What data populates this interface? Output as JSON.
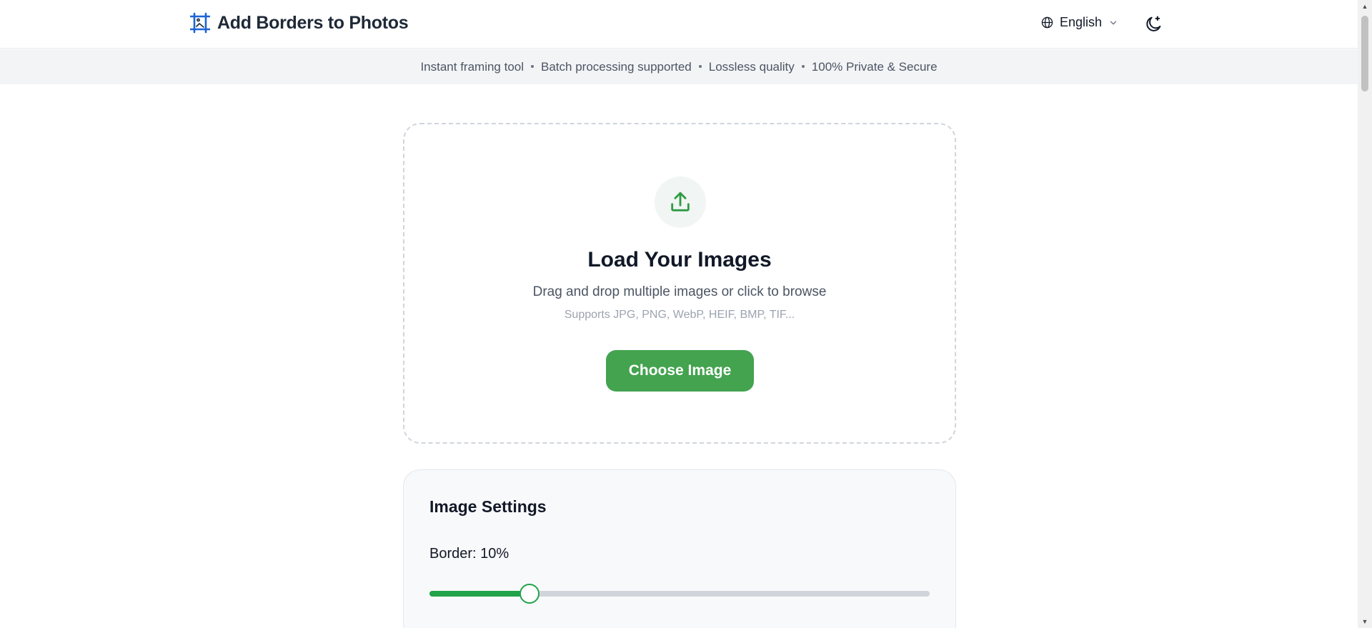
{
  "header": {
    "title": "Add Borders to Photos",
    "language": "English",
    "icons": {
      "logo": "frame-icon",
      "globe": "globe-icon",
      "chevron": "chevron-down-icon",
      "theme": "moon-stars-icon"
    }
  },
  "banner": {
    "items": [
      "Instant framing tool",
      "Batch processing supported",
      "Lossless quality",
      "100% Private & Secure"
    ]
  },
  "upload": {
    "icon": "upload-icon",
    "title": "Load Your Images",
    "subtitle": "Drag and drop multiple images or click to browse",
    "formats": "Supports JPG, PNG, WebP, HEIF, BMP, TIF...",
    "button_label": "Choose Image"
  },
  "settings": {
    "title": "Image Settings",
    "border_label": "Border: 10%",
    "border_slider_fraction": 0.2
  },
  "colors": {
    "accent": "#43a34f",
    "slider": "#22a34a",
    "logo_blue": "#1d63d6"
  }
}
